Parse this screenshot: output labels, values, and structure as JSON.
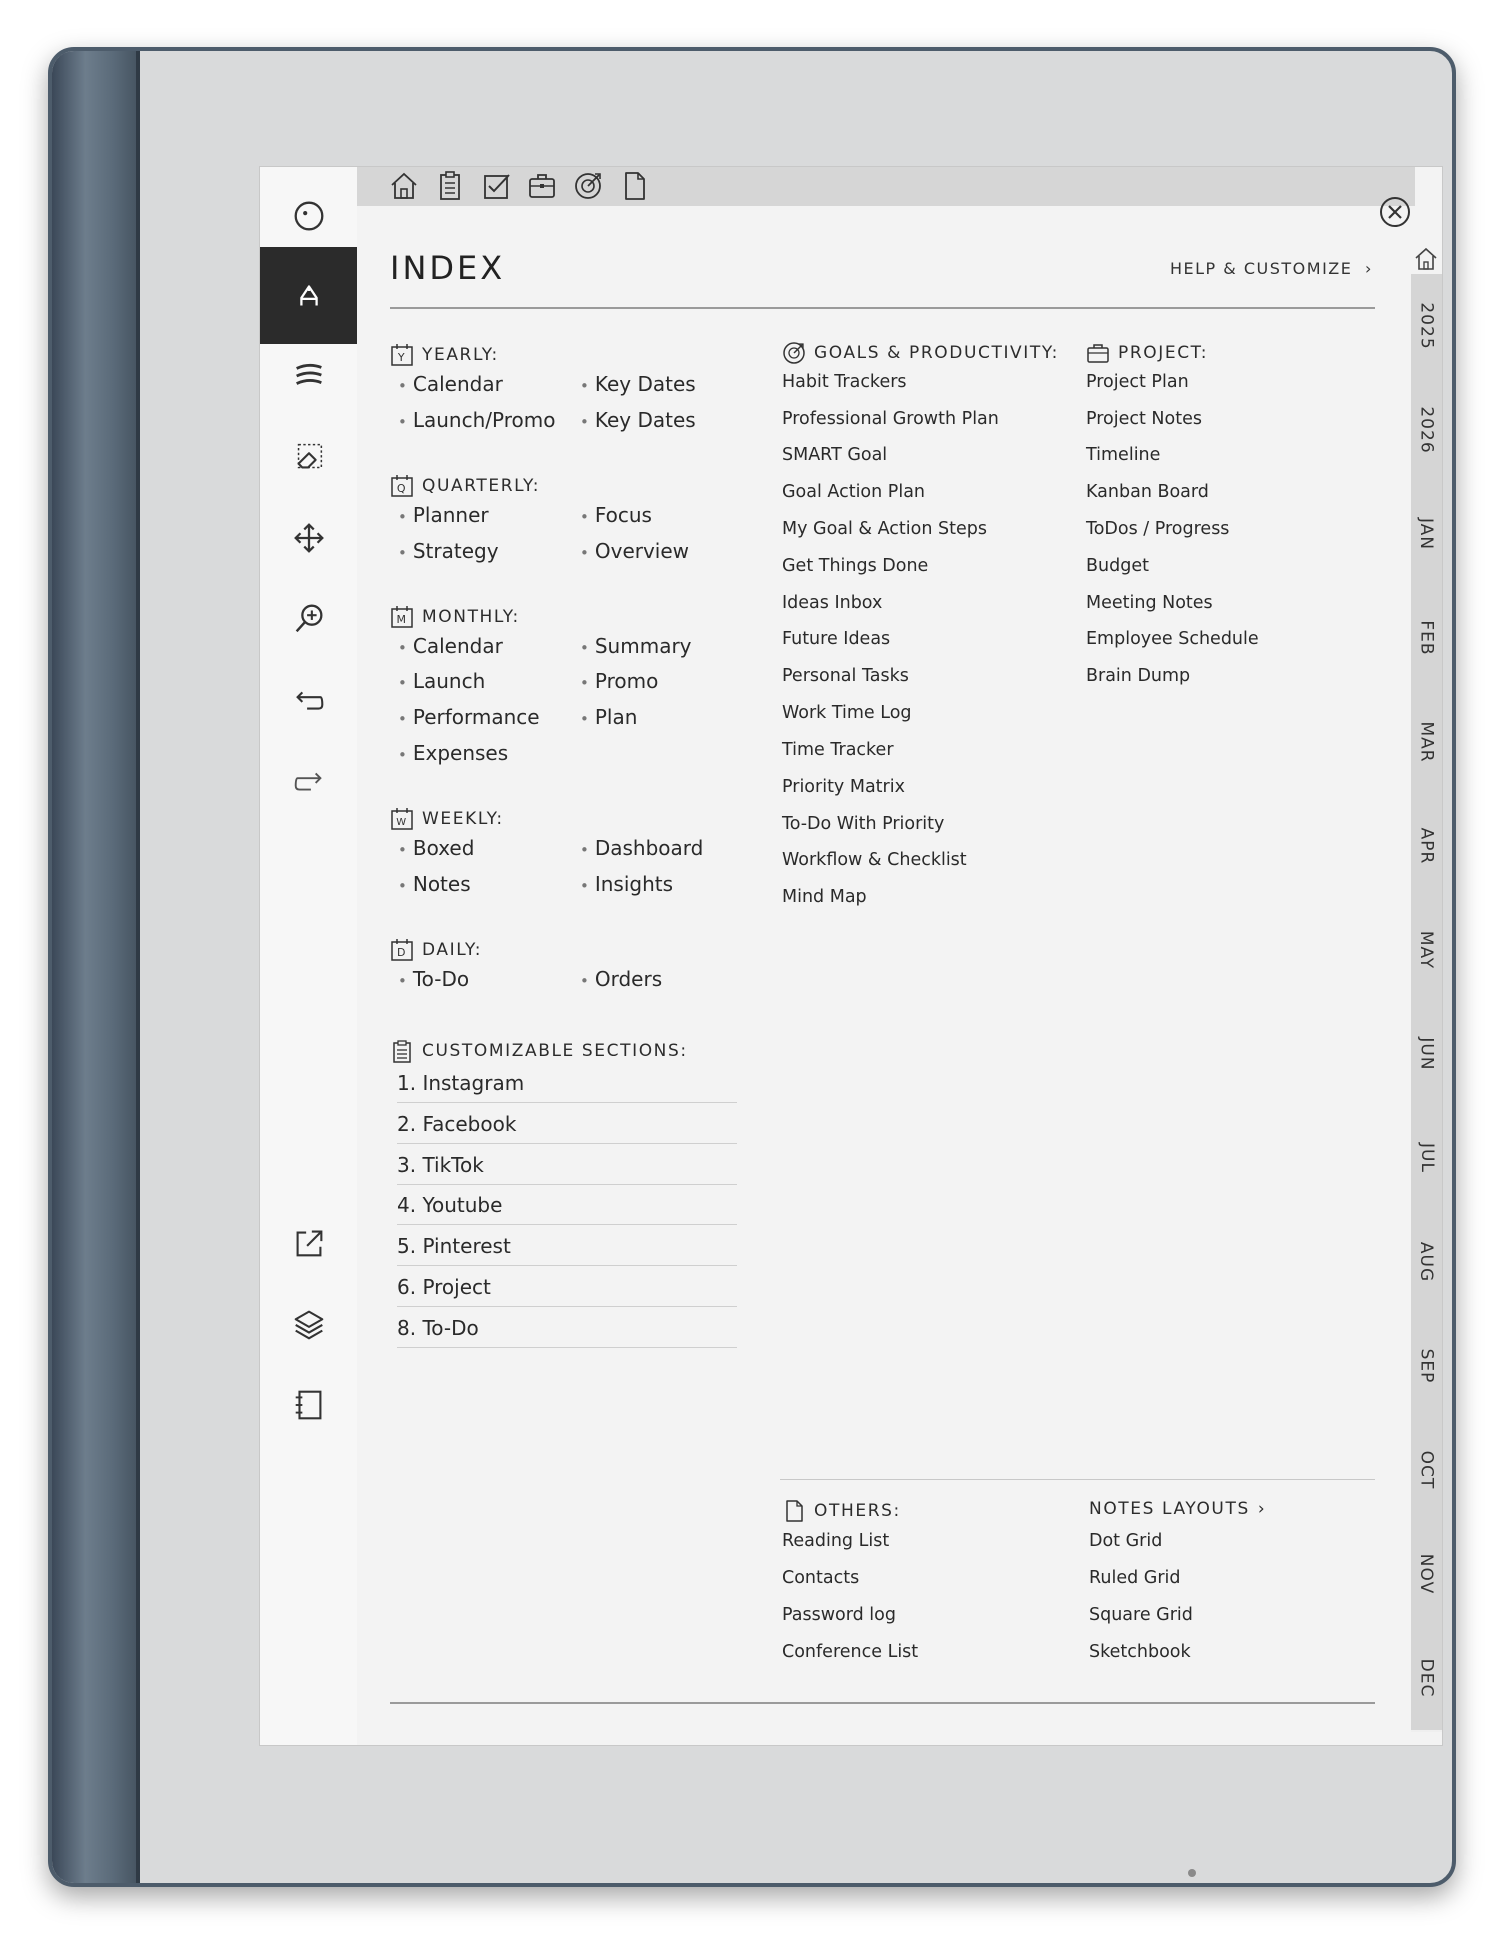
{
  "header": {
    "title": "INDEX",
    "help_label": "HELP & CUSTOMIZE"
  },
  "top_tabs": [
    "home-icon",
    "notes-icon",
    "checkbox-icon",
    "briefcase-icon",
    "goals-icon",
    "page-icon"
  ],
  "side_tabs": [
    "2025",
    "2026",
    "JAN",
    "FEB",
    "MAR",
    "APR",
    "MAY",
    "JUN",
    "JUL",
    "AUG",
    "SEP",
    "OCT",
    "NOV",
    "DEC"
  ],
  "sections": {
    "yearly": {
      "title": "YEARLY:",
      "badge": "Y",
      "left": [
        "Calendar",
        "Launch/Promo"
      ],
      "right": [
        "Key Dates",
        "Key Dates"
      ]
    },
    "quarterly": {
      "title": "QUARTERLY:",
      "badge": "Q",
      "left": [
        "Planner",
        "Strategy"
      ],
      "right": [
        "Focus",
        "Overview"
      ]
    },
    "monthly": {
      "title": "MONTHLY:",
      "badge": "M",
      "left": [
        "Calendar",
        "Launch",
        "Performance",
        "Expenses"
      ],
      "right": [
        "Summary",
        "Promo",
        "Plan"
      ]
    },
    "weekly": {
      "title": "WEEKLY:",
      "badge": "W",
      "left": [
        "Boxed",
        "Notes"
      ],
      "right": [
        "Dashboard",
        "Insights"
      ]
    },
    "daily": {
      "title": "DAILY:",
      "badge": "D",
      "left": [
        "To-Do"
      ],
      "right": [
        "Orders"
      ]
    },
    "customizable": {
      "title": "CUSTOMIZABLE SECTIONS:",
      "items": [
        "1. Instagram",
        "2. Facebook",
        "3. TikTok",
        "4. Youtube",
        "5. Pinterest",
        "6. Project",
        "8. To-Do"
      ]
    },
    "goals": {
      "title": "GOALS & PRODUCTIVITY:",
      "items": [
        "Habit Trackers",
        "Professional Growth Plan",
        "SMART Goal",
        "Goal Action Plan",
        "My Goal & Action Steps",
        "Get Things Done",
        "Ideas Inbox",
        "Future Ideas",
        "Personal Tasks",
        "Work Time Log",
        "Time Tracker",
        "Priority Matrix",
        "To-Do With Priority",
        "Workflow & Checklist",
        "Mind Map"
      ]
    },
    "project": {
      "title": "PROJECT:",
      "items": [
        "Project Plan",
        "Project Notes",
        "Timeline",
        "Kanban Board",
        "ToDos / Progress",
        "Budget",
        "Meeting Notes",
        "Employee Schedule",
        "Brain Dump"
      ]
    },
    "others": {
      "title": "OTHERS:",
      "items": [
        "Reading List",
        "Contacts",
        "Password log",
        "Conference List"
      ]
    },
    "notes_layouts": {
      "title": "NOTES LAYOUTS",
      "items": [
        "Dot Grid",
        "Ruled Grid",
        "Square Grid",
        "Sketchbook"
      ]
    }
  }
}
